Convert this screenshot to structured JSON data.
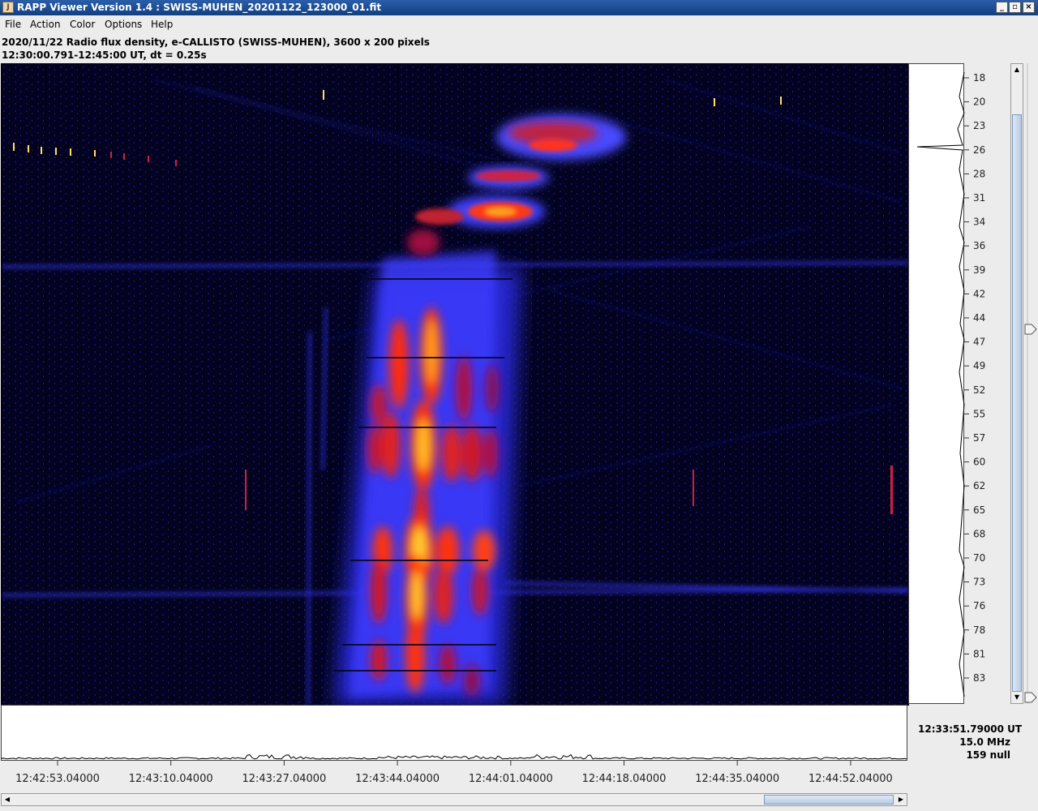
{
  "window": {
    "title": "RAPP Viewer Version 1.4 : SWISS-MUHEN_20201122_123000_01.fit",
    "icon": "java-cup-icon",
    "controls": [
      "minimize",
      "maximize",
      "close"
    ]
  },
  "menu": [
    "File",
    "Action",
    "Color",
    "Options",
    "Help"
  ],
  "info": {
    "line1": "2020/11/22  Radio flux density, e-CALLISTO (SWISS-MUHEN),  3600 x 200 pixels",
    "line2": "12:30:00.791-12:45:00 UT,  dt = 0.25s"
  },
  "frequency_axis": {
    "unit": "MHz",
    "ticks": [
      "18",
      "20",
      "23",
      "26",
      "28",
      "31",
      "34",
      "36",
      "39",
      "42",
      "44",
      "47",
      "49",
      "52",
      "55",
      "57",
      "60",
      "62",
      "65",
      "68",
      "70",
      "73",
      "76",
      "78",
      "81",
      "83"
    ]
  },
  "time_axis": {
    "ticks": [
      "12:42:53.04000",
      "12:43:10.04000",
      "12:43:27.04000",
      "12:43:44.04000",
      "12:44:01.04000",
      "12:44:18.04000",
      "12:44:35.04000",
      "12:44:52.04000"
    ]
  },
  "cursor_readout": {
    "time": "12:33:51.79000 UT",
    "frequency": "15.0 MHz",
    "value": "159 null"
  },
  "colormap": [
    "#02021a",
    "#1010c0",
    "#3a3aff",
    "#b01040",
    "#ff2010",
    "#ff8a10",
    "#ffe830"
  ],
  "scrollbars": {
    "vertical_position": 0.5,
    "horizontal_position": 0.92
  }
}
